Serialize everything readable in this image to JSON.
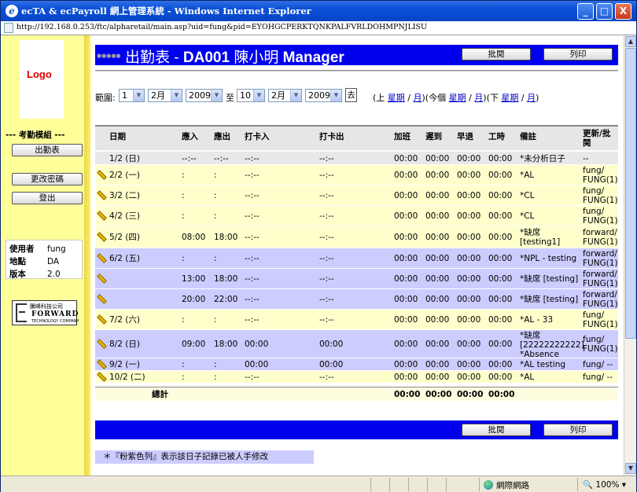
{
  "window": {
    "title": "ecTA & ecPayroll 網上管理系統 - Windows Internet Explorer",
    "url": "http://192.168.0.253/ftc/alpharetail/main.asp?uid=fung&pid=EYOHGCPERKTQNKPALFVRLDOHMPNJLISU",
    "buttons": {
      "minimize": "_",
      "maximize": "□",
      "close": "X"
    }
  },
  "sidebar": {
    "logo": "Logo",
    "module_title": "--- 考勤模組 ---",
    "buttons": [
      "出勤表",
      "更改密碼",
      "登出"
    ],
    "info": [
      {
        "key": "使用者",
        "value": "fung"
      },
      {
        "key": "地點",
        "value": "DA"
      },
      {
        "key": "版本",
        "value": "2.0"
      }
    ],
    "company": {
      "cn": "騰峰科技公司",
      "en": "FORWARD",
      "en2": "TECHNOLOGY COMPANY"
    }
  },
  "header": {
    "title_prefix": "出勤表 - ",
    "title_main": "DA001 ",
    "title_name": "陳小明",
    "title_role": " Manager",
    "approve_label": "批閱",
    "print_label": "列印"
  },
  "range": {
    "label": "範圍:",
    "from_day": "1",
    "from_month": "2月",
    "from_year": "2009",
    "to_label": "至",
    "to_day": "10",
    "to_month": "2月",
    "to_year": "2009",
    "go_label": "去",
    "nav": {
      "open1": "(上 ",
      "prev_week": "星期",
      "sep1": " / ",
      "prev_month": "月",
      "mid1": ")(今個 ",
      "this_week": "星期",
      "sep2": " / ",
      "this_month": "月",
      "mid2": ")(下 ",
      "next_week": "星期",
      "sep3": " / ",
      "next_month": "月",
      "close": ")"
    }
  },
  "table": {
    "headers": [
      "日期",
      "應入",
      "應出",
      "打卡入",
      "打卡出",
      "加班",
      "遲到",
      "早退",
      "工時",
      "備註",
      "更新/批閱"
    ],
    "rows": [
      {
        "date": "1/2 (日)",
        "in": "--:--",
        "out": "--:--",
        "clock_in": "--:--",
        "clock_out": "--:--",
        "ot": "00:00",
        "late": "00:00",
        "early": "00:00",
        "hours": "00:00",
        "remark": "*未分析日子",
        "update": "--",
        "bg": "#e8e8e8",
        "edit": false
      },
      {
        "date": "2/2 (一)",
        "in": ":",
        "out": ":",
        "clock_in": "--:--",
        "clock_out": "--:--",
        "ot": "00:00",
        "late": "00:00",
        "early": "00:00",
        "hours": "00:00",
        "remark": "*AL",
        "update": "fung/\nFUNG(1)",
        "bg": "#ffffcc",
        "edit": true
      },
      {
        "date": "3/2 (二)",
        "in": ":",
        "out": ":",
        "clock_in": "--:--",
        "clock_out": "--:--",
        "ot": "00:00",
        "late": "00:00",
        "early": "00:00",
        "hours": "00:00",
        "remark": "*CL",
        "update": "fung/\nFUNG(1)",
        "bg": "#ffffcc",
        "edit": true
      },
      {
        "date": "4/2 (三)",
        "in": ":",
        "out": ":",
        "clock_in": "--:--",
        "clock_out": "--:--",
        "ot": "00:00",
        "late": "00:00",
        "early": "00:00",
        "hours": "00:00",
        "remark": "*CL",
        "update": "fung/\nFUNG(1)",
        "bg": "#ffffcc",
        "edit": true
      },
      {
        "date": "5/2 (四)",
        "in": "08:00",
        "out": "18:00",
        "clock_in": "--:--",
        "clock_out": "--:--",
        "ot": "00:00",
        "late": "00:00",
        "early": "00:00",
        "hours": "00:00",
        "remark": "*缺席\n[testing1]",
        "update": "forward/\nFUNG(1)",
        "bg": "#ffffcc",
        "edit": true
      },
      {
        "date": "6/2 (五)",
        "in": ":",
        "out": ":",
        "clock_in": "--:--",
        "clock_out": "--:--",
        "ot": "00:00",
        "late": "00:00",
        "early": "00:00",
        "hours": "00:00",
        "remark": "*NPL - testing",
        "update": "forward/\nFUNG(1)",
        "bg": "#ccccff",
        "edit": true
      },
      {
        "date": "",
        "in": "13:00",
        "out": "18:00",
        "clock_in": "--:--",
        "clock_out": "--:--",
        "ot": "00:00",
        "late": "00:00",
        "early": "00:00",
        "hours": "00:00",
        "remark": "*缺席 [testing]",
        "update": "forward/\nFUNG(1)",
        "bg": "#ccccff",
        "edit": true
      },
      {
        "date": "",
        "in": "20:00",
        "out": "22:00",
        "clock_in": "--:--",
        "clock_out": "--:--",
        "ot": "00:00",
        "late": "00:00",
        "early": "00:00",
        "hours": "00:00",
        "remark": "*缺席 [testing]",
        "update": "forward/\nFUNG(1)",
        "bg": "#ccccff",
        "edit": true
      },
      {
        "date": "7/2 (六)",
        "in": ":",
        "out": ":",
        "clock_in": "--:--",
        "clock_out": "--:--",
        "ot": "00:00",
        "late": "00:00",
        "early": "00:00",
        "hours": "00:00",
        "remark": "*AL - 33",
        "update": "fung/\nFUNG(1)",
        "bg": "#ffffcc",
        "edit": true
      },
      {
        "date": "8/2 (日)",
        "in": "09:00",
        "out": "18:00",
        "clock_in": "00:00",
        "clock_out": "00:00",
        "ot": "00:00",
        "late": "00:00",
        "early": "00:00",
        "hours": "00:00",
        "remark": "*缺席\n[22222222222]\n*Absence",
        "update": "fung/\nFUNG(1)",
        "bg": "#ccccff",
        "edit": true
      },
      {
        "date": "9/2 (一)",
        "in": ":",
        "out": ":",
        "clock_in": "00:00",
        "clock_out": "00:00",
        "ot": "00:00",
        "late": "00:00",
        "early": "00:00",
        "hours": "00:00",
        "remark": "*AL testing",
        "update": "fung/ --",
        "bg": "#ccccff",
        "edit": true
      },
      {
        "date": "10/2 (二)",
        "in": ":",
        "out": ":",
        "clock_in": "--:--",
        "clock_out": "--:--",
        "ot": "00:00",
        "late": "00:00",
        "early": "00:00",
        "hours": "00:00",
        "remark": "*AL",
        "update": "fung/ --",
        "bg": "#ffffcc",
        "edit": true
      }
    ],
    "total": {
      "label": "總計",
      "ot": "00:00",
      "late": "00:00",
      "early": "00:00",
      "hours": "00:00"
    }
  },
  "footer_note": "＊『粉紫色列』表示該日子記錄已被人手修改",
  "status": {
    "zone": "網際網路",
    "zoom": "100%"
  }
}
